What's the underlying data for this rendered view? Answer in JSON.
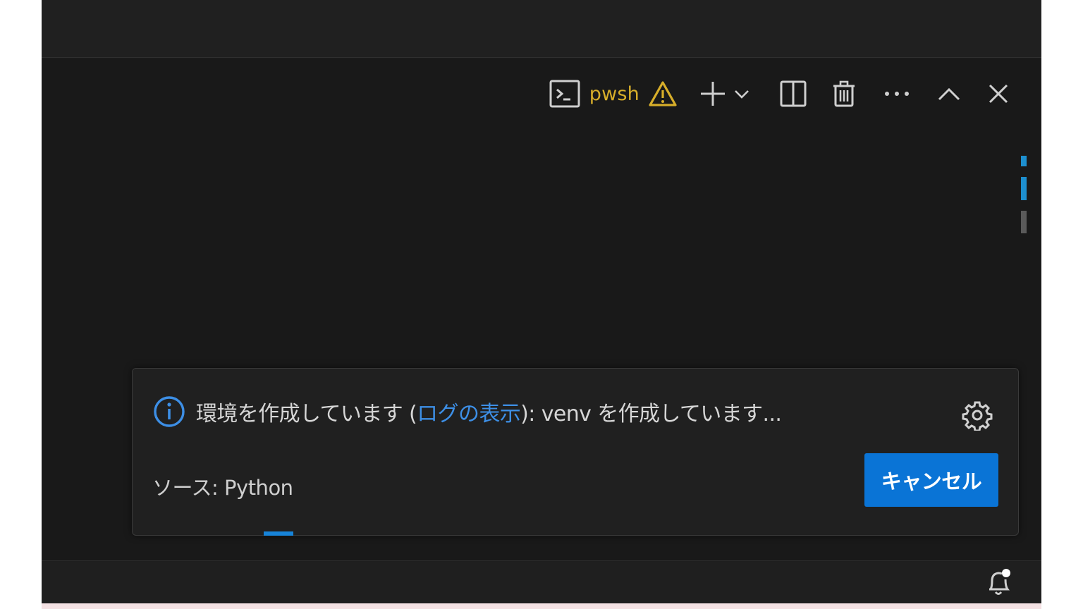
{
  "colors": {
    "terminal_accent": "#d7ae2a",
    "link": "#3d8fe6",
    "primary_button": "#0a74d6",
    "scroll_mark_blue": "#1d8fcf",
    "scroll_mark_gray": "#5a5a5a"
  },
  "terminal_toolbar": {
    "profile_label": "pwsh",
    "icons": [
      "terminal-icon",
      "warning-icon",
      "plus-icon",
      "chevron-down-icon",
      "split-icon",
      "trash-icon",
      "more-icon",
      "chevron-up-icon",
      "close-icon"
    ]
  },
  "notification": {
    "message_prefix": "環境を作成しています (",
    "link_text": "ログの表示",
    "message_suffix": "): venv を作成しています...",
    "source_label": "ソース: Python",
    "cancel_label": "キャンセル"
  },
  "status_bar": {
    "icons": [
      "bell-icon"
    ]
  }
}
